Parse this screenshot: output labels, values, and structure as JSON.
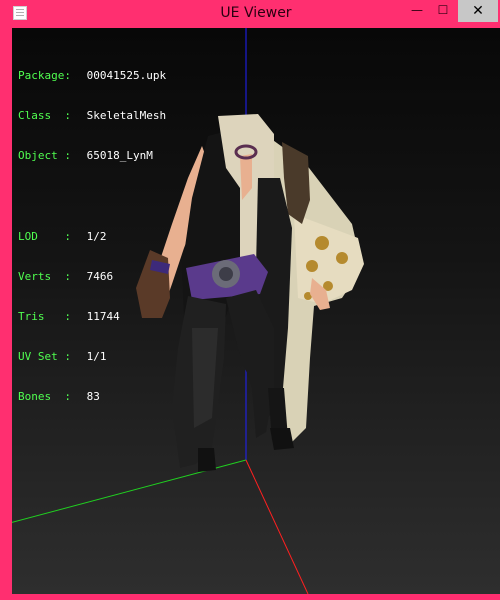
{
  "window": {
    "title": "UE Viewer",
    "minimize": "—",
    "maximize": "☐",
    "close": "✕"
  },
  "info": {
    "package_label": "Package:",
    "package_value": "00041525.upk",
    "class_label": "Class  :",
    "class_value": "SkeletalMesh",
    "object_label": "Object :",
    "object_value": "65018_LynM",
    "lod_label": "LOD    :",
    "lod_value": "1/2",
    "verts_label": "Verts  :",
    "verts_value": "7466",
    "tris_label": "Tris   :",
    "tris_value": "11744",
    "uvset_label": "UV Set :",
    "uvset_value": "1/1",
    "bones_label": "Bones  :",
    "bones_value": "83"
  },
  "colors": {
    "frame": "#ff2f70",
    "axis_x": "#ff2020",
    "axis_y": "#20d020",
    "axis_z": "#2020ff",
    "info_label": "#50ff50",
    "info_value": "#ffffff"
  },
  "icons": {
    "app": "window-app-icon",
    "model": "skeletal-mesh-model"
  }
}
